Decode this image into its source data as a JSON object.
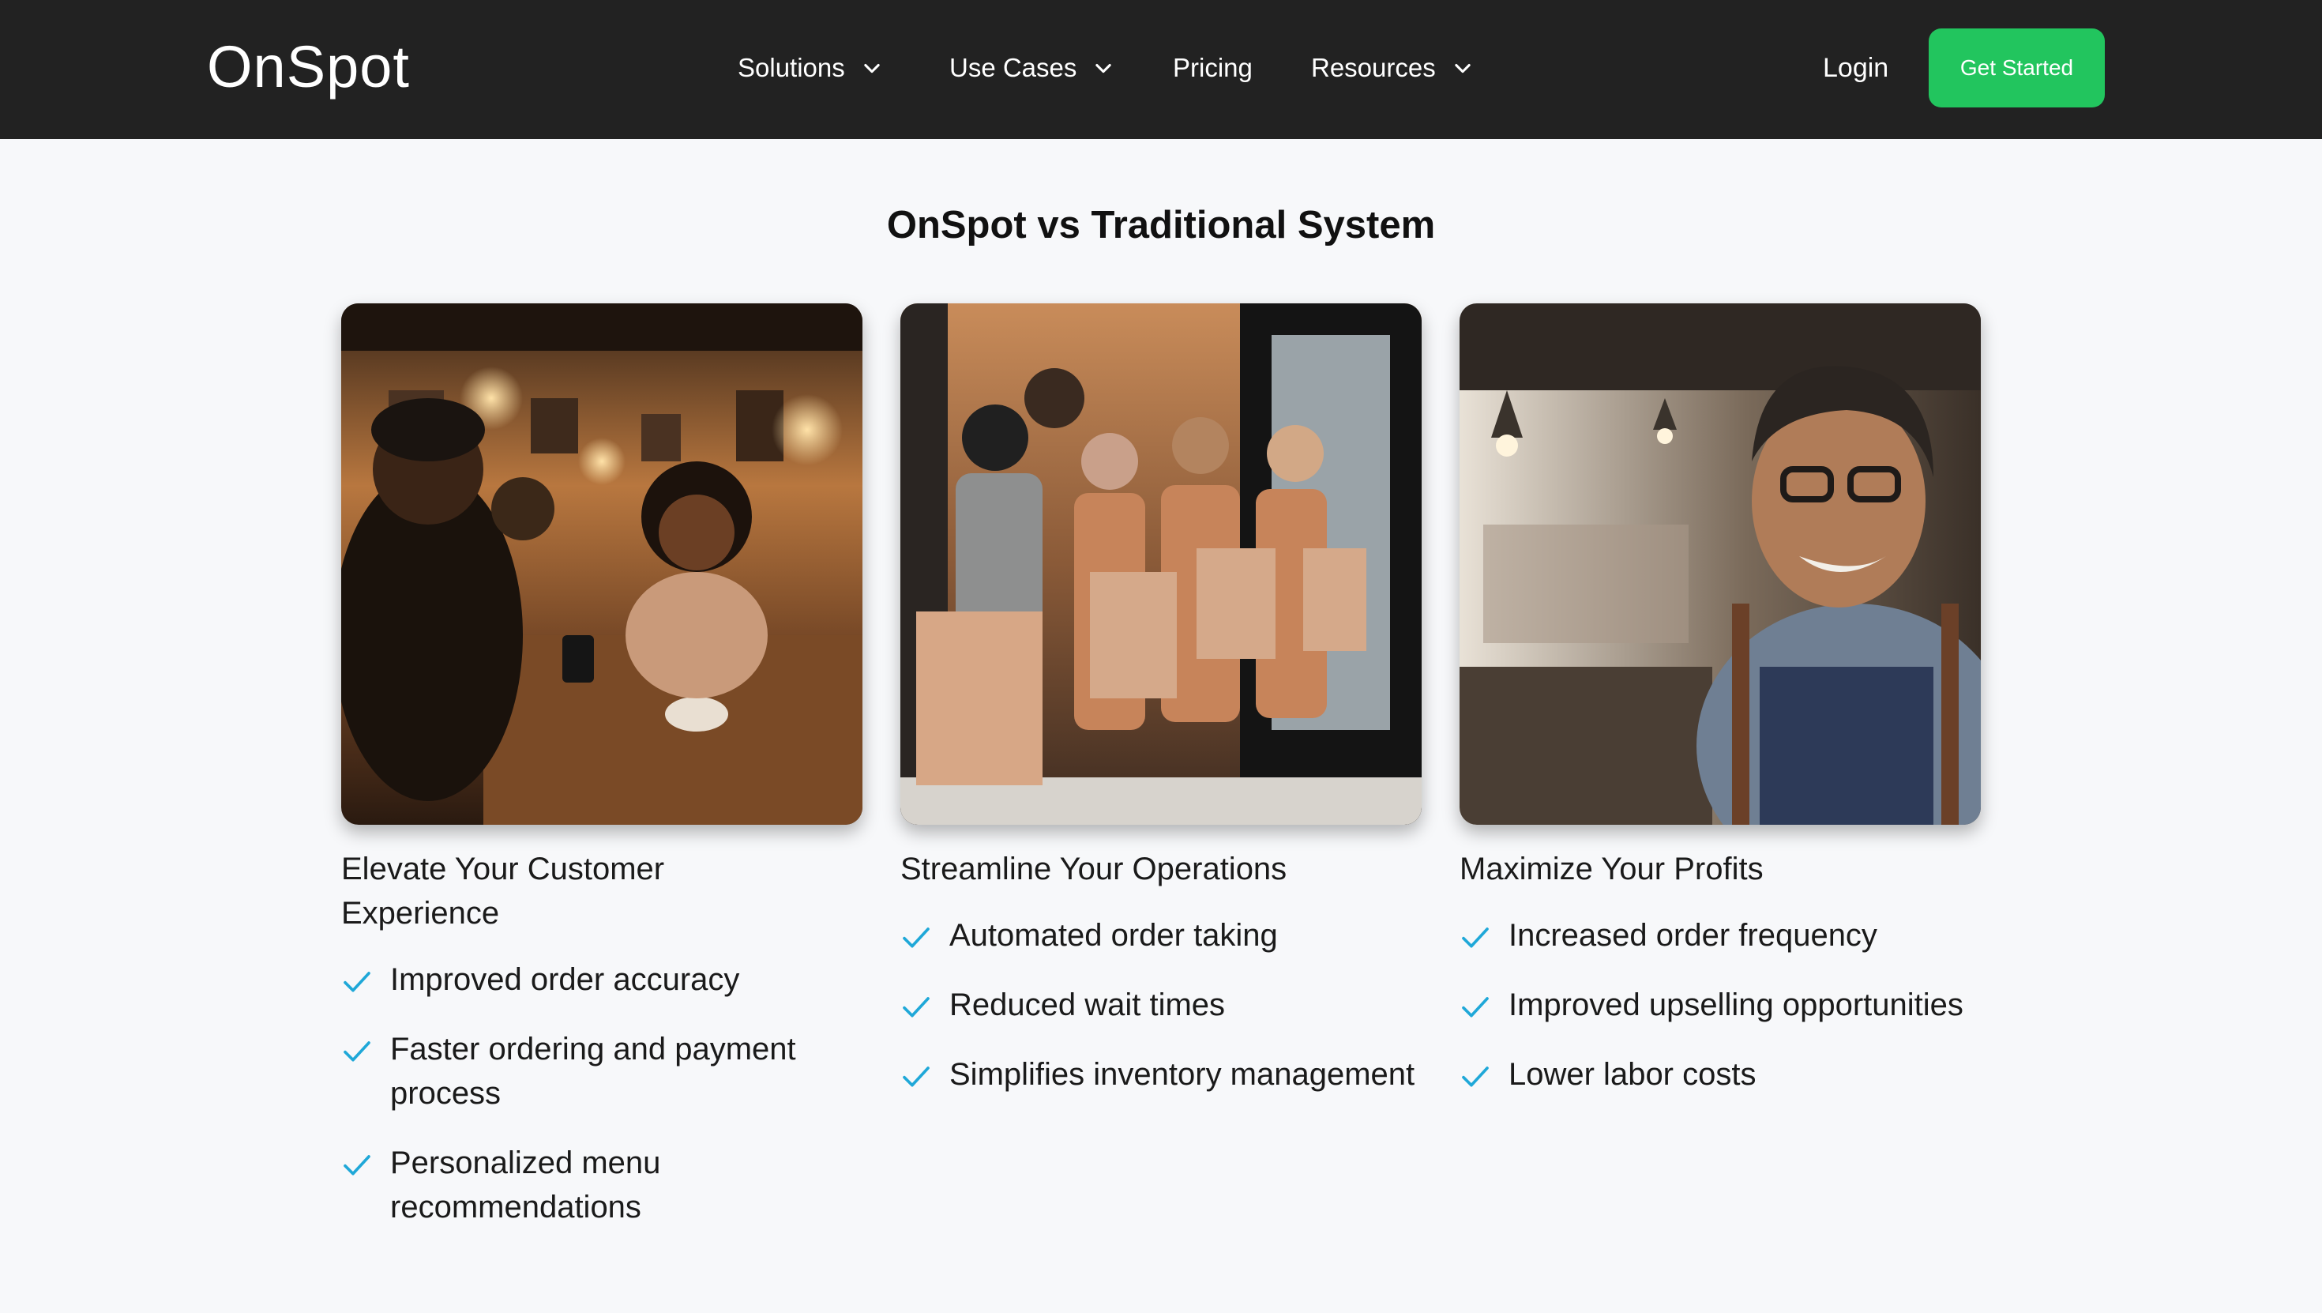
{
  "header": {
    "logo": "OnSpot",
    "nav": [
      {
        "label": "Solutions",
        "has_dropdown": true
      },
      {
        "label": "Use Cases",
        "has_dropdown": true
      },
      {
        "label": "Pricing",
        "has_dropdown": false
      },
      {
        "label": "Resources",
        "has_dropdown": true
      }
    ],
    "login_label": "Login",
    "cta_label": "Get Started"
  },
  "section": {
    "title": "OnSpot vs Traditional System",
    "cards": [
      {
        "image": "cafe-customers-photo",
        "title": "Elevate Your Customer Experience",
        "features": [
          "Improved order accuracy",
          "Faster ordering and payment process",
          "Personalized menu recommendations"
        ]
      },
      {
        "image": "staff-with-bags-photo",
        "title": "Streamline Your Operations",
        "features": [
          "Automated order taking",
          "Reduced wait times",
          "Simplifies inventory management"
        ]
      },
      {
        "image": "smiling-owner-photo",
        "title": "Maximize Your Profits",
        "features": [
          "Increased order frequency",
          "Improved upselling opportunities",
          "Lower labor costs"
        ]
      }
    ]
  },
  "colors": {
    "header_bg": "#222222",
    "cta_bg": "#22c55e",
    "check": "#1fa8d8",
    "page_bg": "#f7f8fa"
  },
  "icons": {
    "dropdown": "chevron-down-icon",
    "feature_bullet": "check-icon"
  }
}
